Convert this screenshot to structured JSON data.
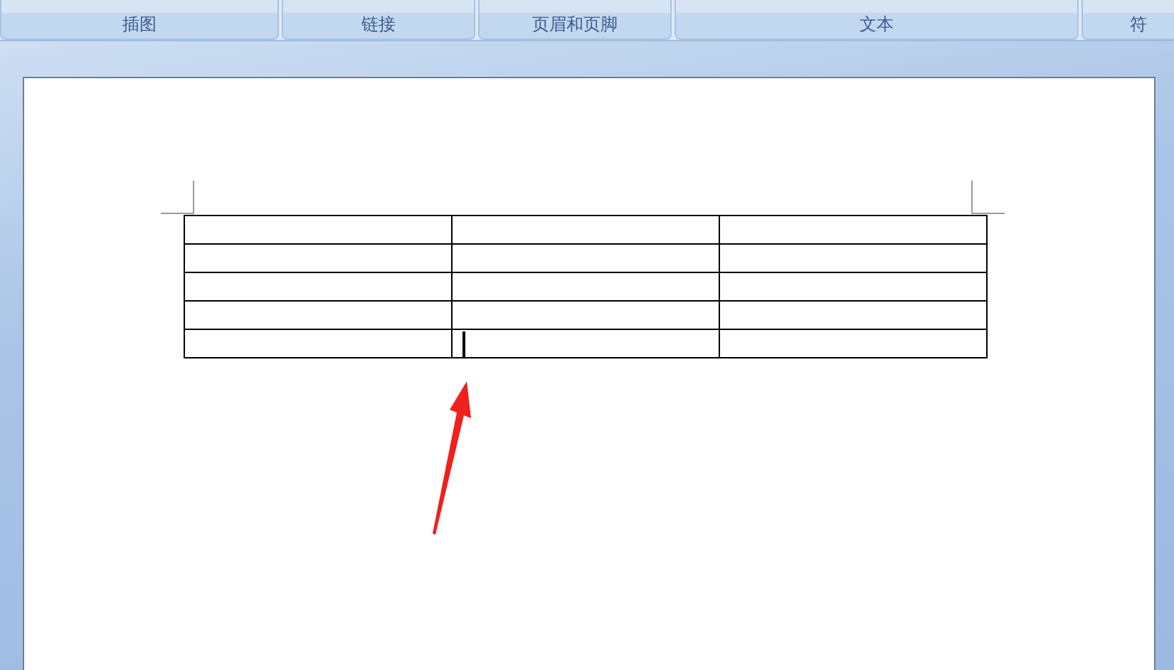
{
  "ribbon_groups": [
    {
      "label": "插图"
    },
    {
      "label": "链接"
    },
    {
      "label": "页眉和页脚"
    },
    {
      "label": "文本"
    },
    {
      "label": "符"
    }
  ],
  "table": {
    "rows": [
      {
        "cells": [
          {
            "cursor": false
          },
          {
            "cursor": false
          },
          {
            "cursor": false
          }
        ]
      },
      {
        "cells": [
          {
            "cursor": false
          },
          {
            "cursor": false
          },
          {
            "cursor": false
          }
        ]
      },
      {
        "cells": [
          {
            "cursor": false
          },
          {
            "cursor": false
          },
          {
            "cursor": false
          }
        ]
      },
      {
        "cells": [
          {
            "cursor": false
          },
          {
            "cursor": false
          },
          {
            "cursor": false
          }
        ]
      },
      {
        "cells": [
          {
            "cursor": false
          },
          {
            "cursor": true
          },
          {
            "cursor": false
          }
        ]
      }
    ]
  }
}
